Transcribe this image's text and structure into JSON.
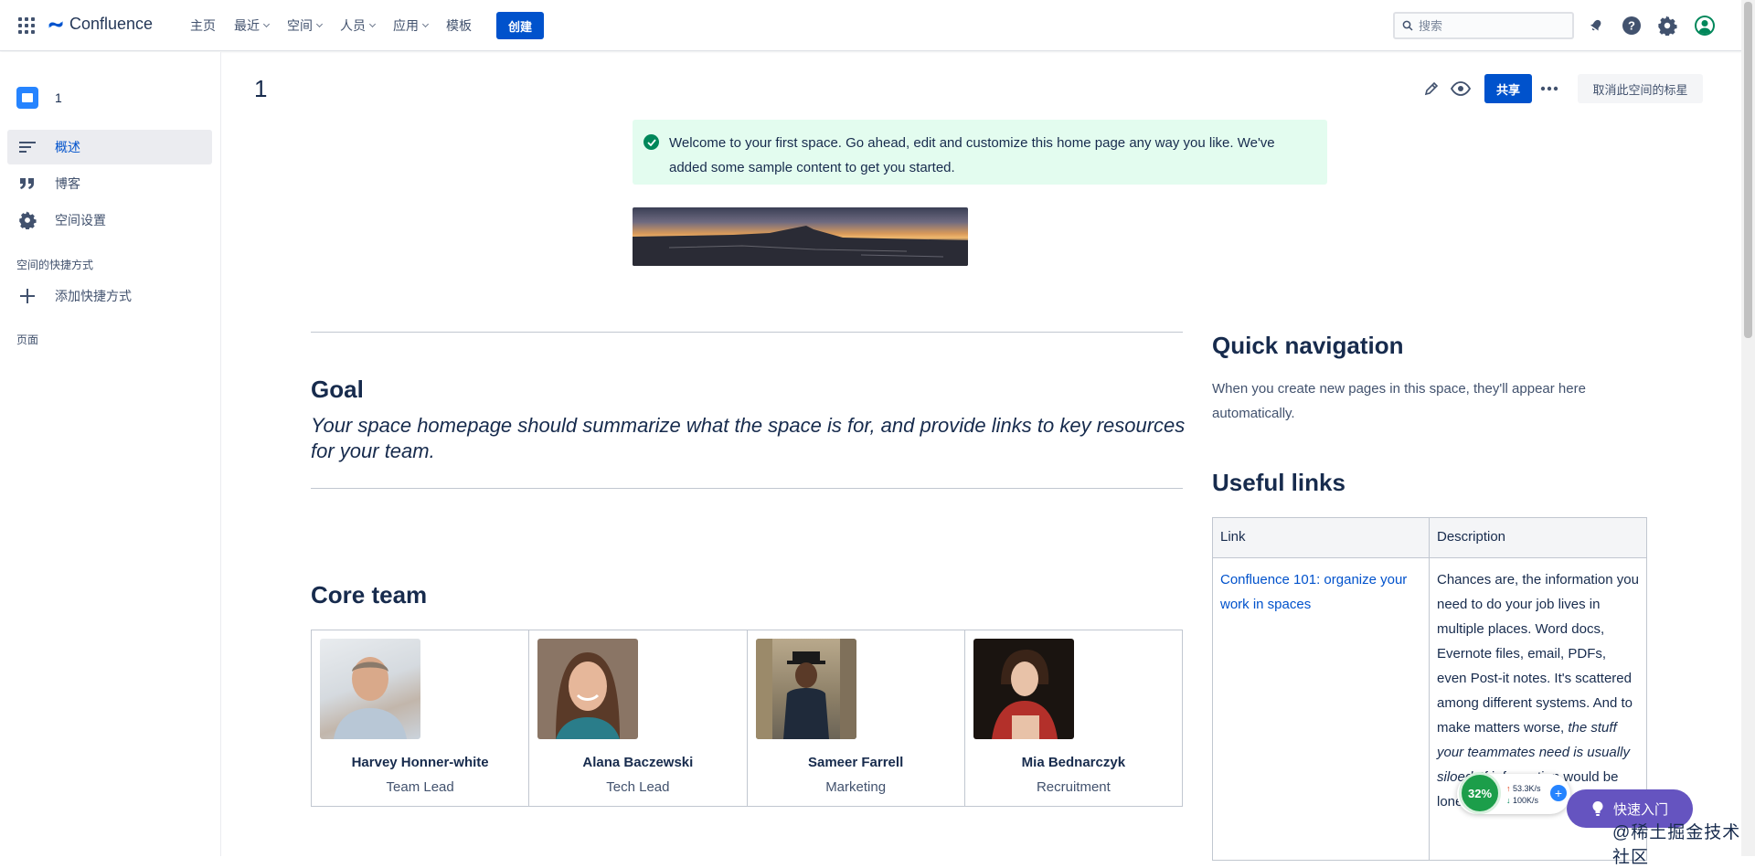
{
  "header": {
    "product": "Confluence",
    "nav": [
      {
        "label": "主页",
        "dropdown": false
      },
      {
        "label": "最近",
        "dropdown": true
      },
      {
        "label": "空间",
        "dropdown": true
      },
      {
        "label": "人员",
        "dropdown": true
      },
      {
        "label": "应用",
        "dropdown": true
      },
      {
        "label": "模板",
        "dropdown": false
      }
    ],
    "create_label": "创建",
    "search_placeholder": "搜索",
    "brand_color": "#0052cc"
  },
  "sidebar": {
    "space_name": "1",
    "items": [
      {
        "label": "概述",
        "icon": "overview-lines-icon",
        "active": true
      },
      {
        "label": "博客",
        "icon": "quote-icon",
        "active": false
      },
      {
        "label": "空间设置",
        "icon": "gear-icon",
        "active": false
      }
    ],
    "shortcuts_heading": "空间的快捷方式",
    "add_shortcut_label": "添加快捷方式",
    "pages_heading": "页面"
  },
  "page": {
    "title": "1",
    "share_label": "共享",
    "unstar_label": "取消此空间的标星",
    "info_message": "Welcome to your first space. Go ahead, edit and customize this home page any way you like. We've added some sample content to get you started.",
    "goal_heading": "Goal",
    "goal_text": "Your space homepage should summarize what the space is for, and provide links to key resources for your team.",
    "core_team_heading": "Core team",
    "team": [
      {
        "name": "Harvey Honner-white",
        "role": "Team Lead"
      },
      {
        "name": "Alana Baczewski",
        "role": "Tech Lead"
      },
      {
        "name": "Sameer Farrell",
        "role": "Marketing"
      },
      {
        "name": "Mia Bednarczyk",
        "role": "Recruitment"
      }
    ],
    "quick_nav_heading": "Quick navigation",
    "quick_nav_text": "When you create new pages in this space, they'll appear here automatically.",
    "useful_links_heading": "Useful links",
    "links_table": {
      "headers": [
        "Link",
        "Description"
      ],
      "rows": [
        {
          "link": "Confluence 101: organize your work in spaces",
          "desc_a": "Chances are, the information you need to do your job lives in multiple places. Word docs, Evernote files, email, PDFs, even Post-it notes. It's scattered among different systems. And to make matters worse, ",
          "desc_em": "the stuff your teammates need is usually siloed",
          "desc_b": ". If information would be lonely."
        }
      ]
    }
  },
  "overlays": {
    "net_percent": "32%",
    "net_up": "53.3K/s",
    "net_down": "100K/s",
    "quickstart_label": "快速入门",
    "watermark": "@稀土掘金技术社区"
  }
}
